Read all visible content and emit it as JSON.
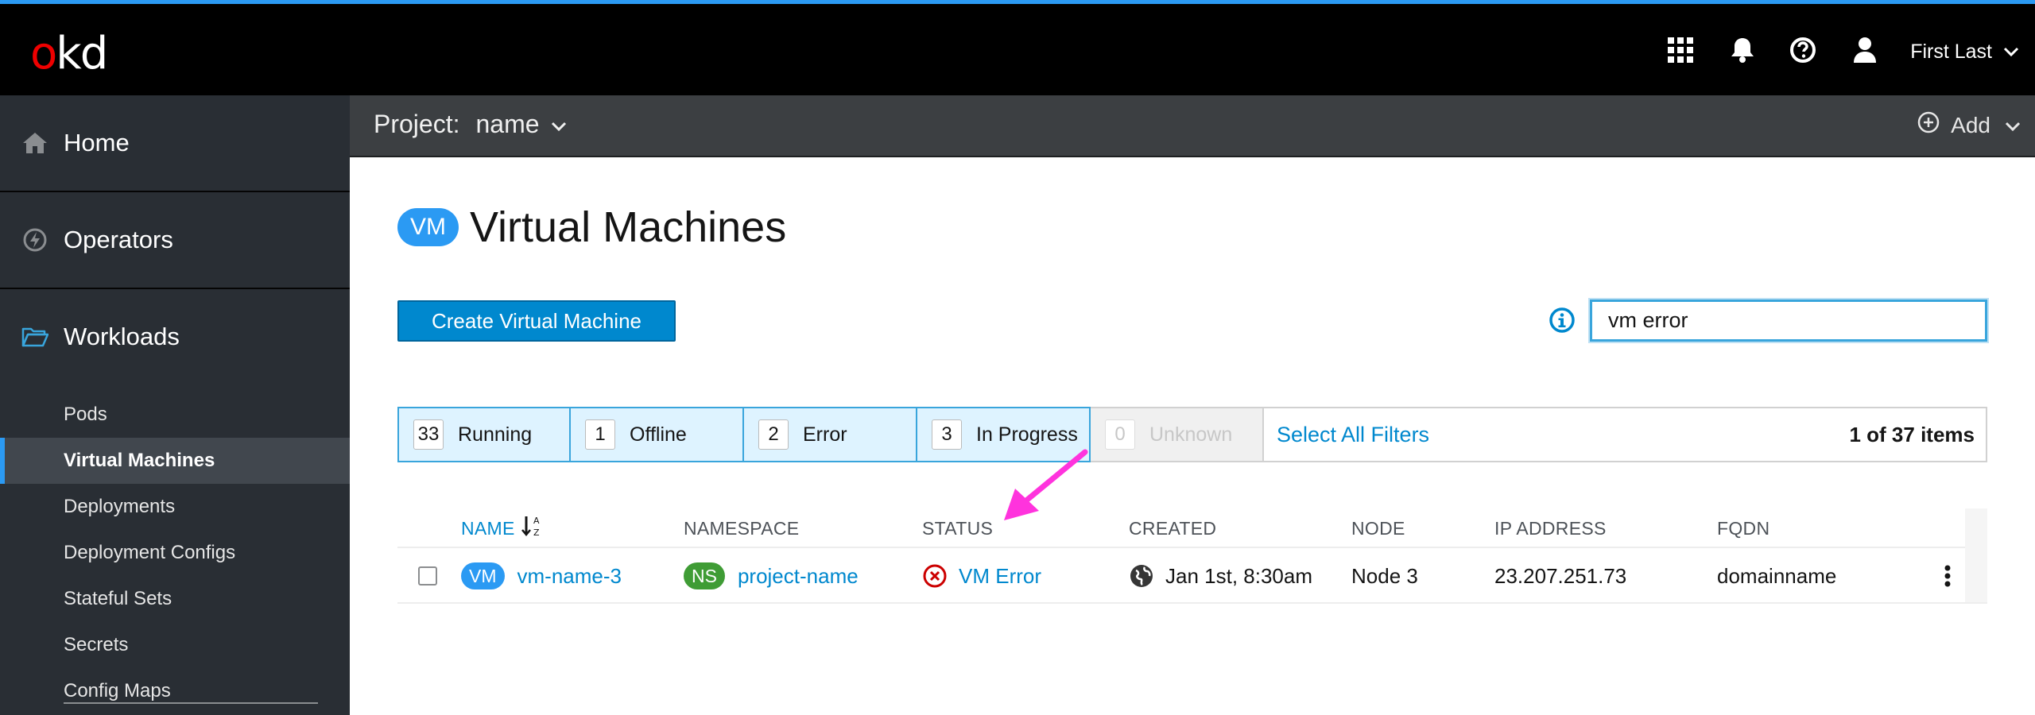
{
  "masthead": {
    "logo_o": "o",
    "logo_rest": "kd",
    "user_name": "First Last",
    "icons": [
      "grid-icon",
      "bell-icon",
      "help-icon",
      "user-icon"
    ],
    "accent": "#2b9af3"
  },
  "sidebar": {
    "sections": [
      {
        "label": "Home",
        "icon": "home-icon"
      },
      {
        "label": "Operators",
        "icon": "bolt-icon"
      },
      {
        "label": "Workloads",
        "icon": "folder-open-icon"
      }
    ],
    "items": [
      {
        "label": "Pods",
        "active": false
      },
      {
        "label": "Virtual Machines",
        "active": true
      },
      {
        "label": "Deployments",
        "active": false
      },
      {
        "label": "Deployment Configs",
        "active": false
      },
      {
        "label": "Stateful Sets",
        "active": false
      },
      {
        "label": "Secrets",
        "active": false
      },
      {
        "label": "Config Maps",
        "active": false
      }
    ]
  },
  "projectbar": {
    "label": "Project:",
    "value": "name",
    "add_label": "Add"
  },
  "page": {
    "badge": "VM",
    "title": "Virtual Machines",
    "create_label": "Create Virtual Machine",
    "search_value": "vm error"
  },
  "filters": {
    "chips": [
      {
        "count": "33",
        "label": "Running",
        "enabled": true
      },
      {
        "count": "1",
        "label": "Offline",
        "enabled": true
      },
      {
        "count": "2",
        "label": "Error",
        "enabled": true
      },
      {
        "count": "3",
        "label": "In Progress",
        "enabled": true
      },
      {
        "count": "0",
        "label": "Unknown",
        "enabled": false
      }
    ],
    "select_all": "Select All Filters",
    "item_count": "1 of 37 items"
  },
  "table": {
    "headers": [
      "NAME",
      "NAMESPACE",
      "STATUS",
      "CREATED",
      "NODE",
      "IP ADDRESS",
      "FQDN"
    ],
    "rows": [
      {
        "name_badge": "VM",
        "name": "vm-name-3",
        "ns_badge": "NS",
        "namespace": "project-name",
        "status": "VM Error",
        "created": "Jan 1st, 8:30am",
        "node": "Node 3",
        "ip": "23.207.251.73",
        "fqdn": "domainname"
      }
    ]
  },
  "colors": {
    "link": "#0088ce",
    "error": "#cc0000",
    "annotation_arrow": "#ff33dd"
  }
}
